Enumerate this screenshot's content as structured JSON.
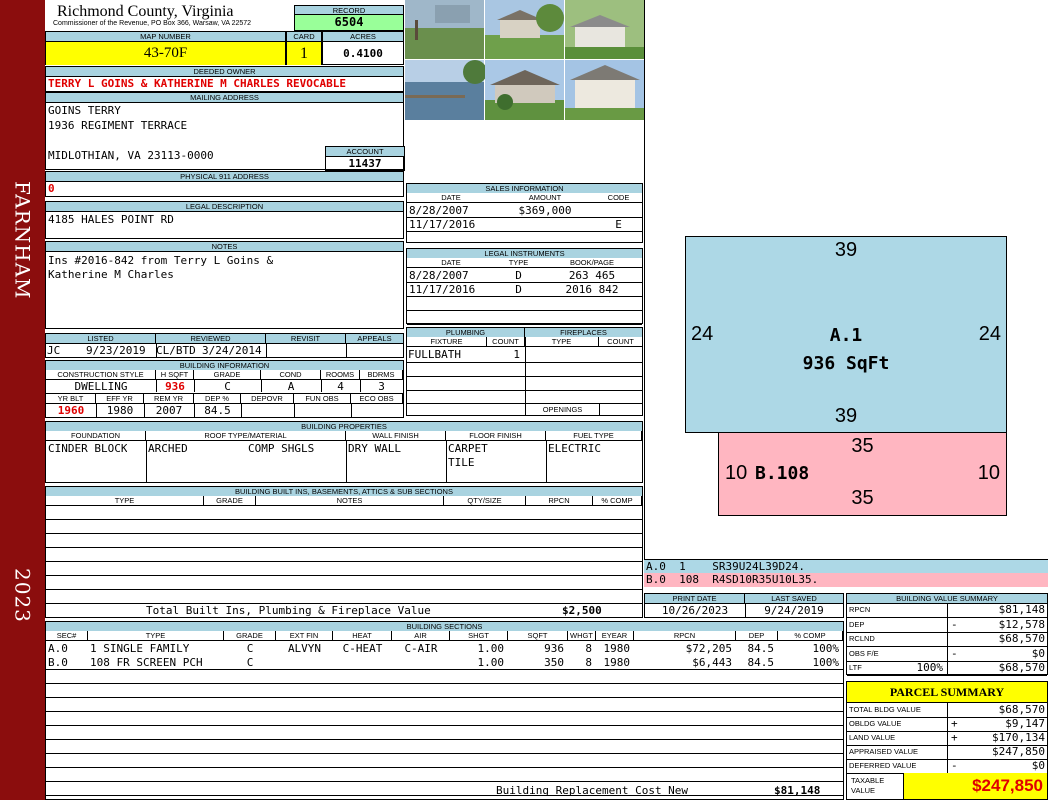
{
  "sidebar": {
    "district": "FARNHAM",
    "year": "2023"
  },
  "header": {
    "county": "Richmond County, Virginia",
    "office": "Commissioner of the Revenue, PO Box 366, Warsaw, VA 22572",
    "record_label": "RECORD",
    "record": "6504",
    "map_label": "MAP NUMBER",
    "map_number": "43-70F",
    "card_label": "CARD",
    "card": "1",
    "acres_label": "ACRES",
    "acres": "0.4100"
  },
  "owner": {
    "label": "DEEDED OWNER",
    "name": "TERRY L GOINS & KATHERINE M CHARLES REVOCABLE"
  },
  "mailing": {
    "label": "MAILING ADDRESS",
    "line1": "GOINS TERRY",
    "line2": "1936 REGIMENT TERRACE",
    "line3": "MIDLOTHIAN, VA 23113-0000"
  },
  "account": {
    "label": "ACCOUNT",
    "value": "11437"
  },
  "physical": {
    "label": "PHYSICAL 911 ADDRESS",
    "value": "0"
  },
  "legal": {
    "label": "LEGAL DESCRIPTION",
    "value": "4185 HALES POINT RD"
  },
  "notes": {
    "label": "NOTES",
    "line1": "Ins #2016-842 from Terry L Goins &",
    "line2": "Katherine M Charles"
  },
  "listing": {
    "listed_label": "LISTED",
    "reviewed_label": "REVIEWED",
    "revisit_label": "REVISIT",
    "appeals_label": "APPEALS",
    "listed_by": "JC",
    "listed_date": "9/23/2019",
    "reviewed_by": "CL/BTD",
    "reviewed_date": "3/24/2014"
  },
  "building_info": {
    "label": "BUILDING INFORMATION",
    "headers": [
      "CONSTRUCTION STYLE",
      "H SQFT",
      "GRADE",
      "COND",
      "ROOMS",
      "BDRMS"
    ],
    "values": [
      "DWELLING",
      "936",
      "C",
      "A",
      "4",
      "3"
    ],
    "headers2": [
      "YR BLT",
      "EFF YR",
      "REM YR",
      "DEP %",
      "DEPOVR",
      "FUN OBS",
      "ECO OBS"
    ],
    "values2": [
      "1960",
      "1980",
      "2007",
      "84.5",
      "",
      "",
      ""
    ]
  },
  "sales": {
    "label": "SALES INFORMATION",
    "headers": [
      "DATE",
      "AMOUNT",
      "CODE"
    ],
    "rows": [
      [
        "8/28/2007",
        "$369,000",
        ""
      ],
      [
        "11/17/2016",
        "",
        "E"
      ]
    ]
  },
  "instruments": {
    "label": "LEGAL INSTRUMENTS",
    "headers": [
      "DATE",
      "TYPE",
      "BOOK/PAGE"
    ],
    "rows": [
      [
        "8/28/2007",
        "D",
        "263 465"
      ],
      [
        "11/17/2016",
        "D",
        "2016 842"
      ]
    ]
  },
  "plumbing": {
    "label": "PLUMBING",
    "headers": [
      "FIXTURE",
      "COUNT"
    ],
    "rows": [
      [
        "FULLBATH",
        "1"
      ]
    ]
  },
  "fireplaces": {
    "label": "FIREPLACES",
    "headers": [
      "TYPE",
      "COUNT"
    ],
    "openings_label": "OPENINGS"
  },
  "properties": {
    "label": "BUILDING PROPERTIES",
    "headers": [
      "FOUNDATION",
      "ROOF TYPE/MATERIAL",
      "WALL FINISH",
      "FLOOR FINISH",
      "FUEL TYPE"
    ],
    "foundation": "CINDER BLOCK",
    "roof_type": "ARCHED",
    "roof_material": "COMP SHGLS",
    "wall": "DRY WALL",
    "floor1": "CARPET",
    "floor2": "TILE",
    "fuel": "ELECTRIC"
  },
  "builtins": {
    "label": "BUILDING BUILT INS, BASEMENTS, ATTICS & SUB SECTIONS",
    "headers": [
      "TYPE",
      "GRADE",
      "NOTES",
      "QTY/SIZE",
      "RPCN",
      "% COMP"
    ],
    "total_label": "Total Built Ins, Plumbing & Fireplace Value",
    "total": "$2,500"
  },
  "sketch": {
    "a": {
      "top": "39",
      "left": "24",
      "right": "24",
      "bottom": "39",
      "id": "A.1",
      "area": "936 SqFt"
    },
    "b": {
      "top": "35",
      "left": "10",
      "right": "10",
      "bottom": "35",
      "id": "B.108"
    },
    "legend_a": "A.0  1    SR39U24L39D24.",
    "legend_b": "B.0  108  R4SD10R35U10L35.",
    "color_a": "#add8e6",
    "color_b": "#ffb6c1"
  },
  "dates": {
    "print_label": "PRINT DATE",
    "print": "10/26/2023",
    "saved_label": "LAST SAVED",
    "saved": "9/24/2019"
  },
  "sections": {
    "label": "BUILDING SECTIONS",
    "headers": [
      "SEC#",
      "TYPE",
      "GRADE",
      "EXT FIN",
      "HEAT",
      "AIR",
      "SHGT",
      "SQFT",
      "WHGT",
      "EYEAR",
      "RPCN",
      "DEP",
      "% COMP"
    ],
    "rows": [
      [
        "A.0",
        "1 SINGLE FAMILY",
        "C",
        "ALVYN",
        "C-HEAT",
        "C-AIR",
        "1.00",
        "936",
        "8",
        "1980",
        "$72,205",
        "84.5",
        "100%"
      ],
      [
        "B.0",
        "108 FR SCREEN PCH",
        "C",
        "",
        "",
        "",
        "1.00",
        "350",
        "8",
        "1980",
        "$6,443",
        "84.5",
        "100%"
      ]
    ],
    "total_label": "Building Replacement Cost New",
    "total": "$81,148"
  },
  "value_summary": {
    "label": "BUILDING VALUE SUMMARY",
    "rows": [
      {
        "k": "RPCN",
        "s": "",
        "v": "$81,148"
      },
      {
        "k": "DEP",
        "s": "-",
        "v": "$12,578"
      },
      {
        "k": "RCLND",
        "s": "",
        "v": "$68,570"
      },
      {
        "k": "OBS F/E",
        "s": "-",
        "v": "$0"
      },
      {
        "k": "LTF",
        "p": "100%",
        "s": "",
        "v": "$68,570"
      }
    ]
  },
  "parcel": {
    "label": "PARCEL SUMMARY",
    "rows": [
      {
        "k": "TOTAL BLDG VALUE",
        "s": "",
        "v": "$68,570"
      },
      {
        "k": "OBLDG VALUE",
        "s": "+",
        "v": "$9,147"
      },
      {
        "k": "LAND VALUE",
        "s": "+",
        "v": "$170,134"
      },
      {
        "k": "APPRAISED VALUE",
        "s": "",
        "v": "$247,850"
      },
      {
        "k": "DEFERRED VALUE",
        "s": "-",
        "v": "$0"
      }
    ],
    "taxable_label": "TAXABLE VALUE",
    "taxable": "$247,850"
  }
}
